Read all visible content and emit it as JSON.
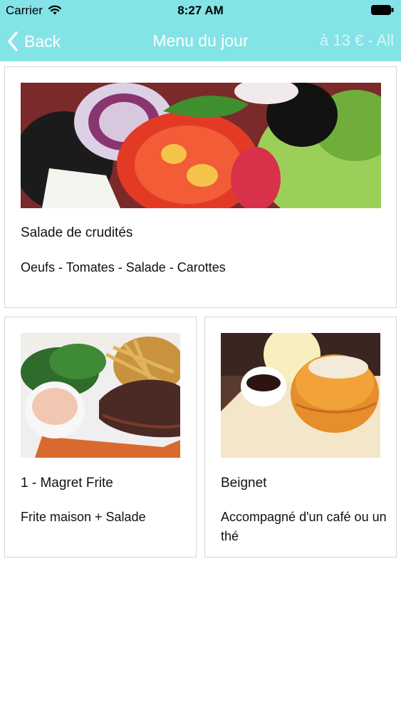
{
  "status_bar": {
    "carrier": "Carrier",
    "time": "8:27 AM"
  },
  "nav": {
    "back_label": "Back",
    "title": "Menu du jour",
    "right_label": "à 13 € - All"
  },
  "colors": {
    "header_bg": "#84e3e6",
    "header_text": "#ffffff",
    "card_border": "#d6d6d6"
  },
  "menu_items": [
    {
      "name": "Salade de crudités",
      "description": "Oeufs - Tomates - Salade - Carottes",
      "photo": "salad-photo"
    },
    {
      "name": "1 - Magret Frite",
      "description": "Frite maison + Salade",
      "photo": "duck-fries-photo"
    },
    {
      "name": "Beignet",
      "description": "Accompagné d'un café ou un thé",
      "photo": "beignet-photo"
    }
  ]
}
